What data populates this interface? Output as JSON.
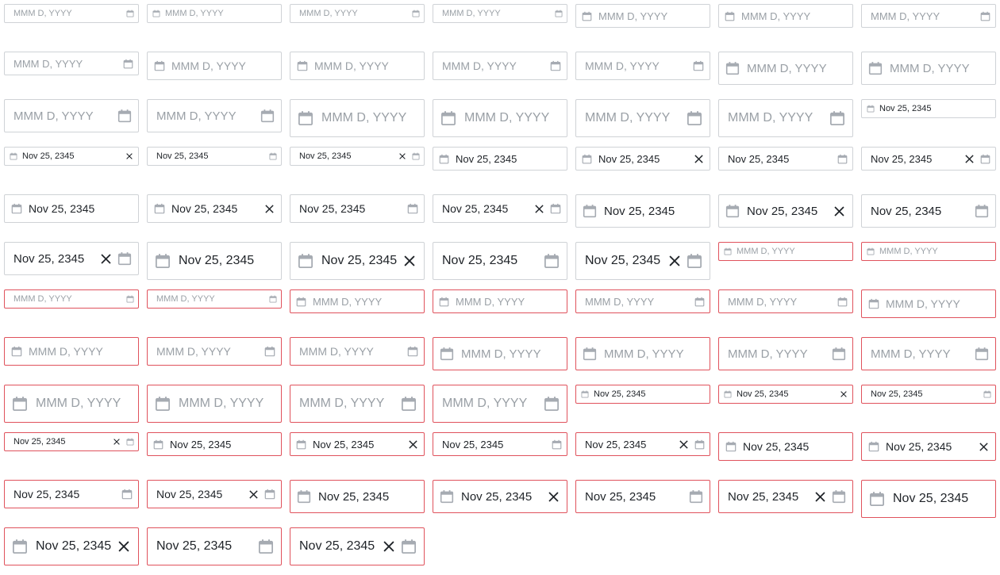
{
  "placeholder": "MMM D, YYYY",
  "date_value": "Nov 25, 2345",
  "colors": {
    "border": "#cfd2d6",
    "invalid_border": "#e0525c",
    "icon": "#a6abb2",
    "text": "#1f2328",
    "placeholder": "#9aa0a6"
  },
  "icons": {
    "calendar": "calendar-icon",
    "clear": "close-icon"
  },
  "fields": [
    {
      "size": "xs",
      "icon": "right",
      "invalid": false,
      "filled": false,
      "clear": false
    },
    {
      "size": "xs",
      "icon": "left",
      "invalid": false,
      "filled": false,
      "clear": false
    },
    {
      "size": "xs",
      "icon": "right",
      "invalid": false,
      "filled": false,
      "clear": false
    },
    {
      "size": "xs",
      "icon": "right",
      "invalid": false,
      "filled": false,
      "clear": false
    },
    {
      "size": "s",
      "icon": "left",
      "invalid": false,
      "filled": false,
      "clear": false
    },
    {
      "size": "s",
      "icon": "left",
      "invalid": false,
      "filled": false,
      "clear": false
    },
    {
      "size": "s",
      "icon": "right",
      "invalid": false,
      "filled": false,
      "clear": false
    },
    {
      "size": "s",
      "icon": "right",
      "invalid": false,
      "filled": false,
      "clear": false
    },
    {
      "size": "m",
      "icon": "left",
      "invalid": false,
      "filled": false,
      "clear": false
    },
    {
      "size": "m",
      "icon": "left",
      "invalid": false,
      "filled": false,
      "clear": false
    },
    {
      "size": "m",
      "icon": "right",
      "invalid": false,
      "filled": false,
      "clear": false
    },
    {
      "size": "m",
      "icon": "right",
      "invalid": false,
      "filled": false,
      "clear": false
    },
    {
      "size": "l",
      "icon": "left",
      "invalid": false,
      "filled": false,
      "clear": false
    },
    {
      "size": "l",
      "icon": "left",
      "invalid": false,
      "filled": false,
      "clear": false
    },
    {
      "size": "l",
      "icon": "right",
      "invalid": false,
      "filled": false,
      "clear": false
    },
    {
      "size": "l",
      "icon": "right",
      "invalid": false,
      "filled": false,
      "clear": false
    },
    {
      "size": "xl",
      "icon": "left",
      "invalid": false,
      "filled": false,
      "clear": false
    },
    {
      "size": "xl",
      "icon": "left",
      "invalid": false,
      "filled": false,
      "clear": false
    },
    {
      "size": "xl",
      "icon": "right",
      "invalid": false,
      "filled": false,
      "clear": false
    },
    {
      "size": "xl",
      "icon": "right",
      "invalid": false,
      "filled": false,
      "clear": false
    },
    {
      "size": "xs",
      "icon": "left",
      "invalid": false,
      "filled": true,
      "clear": false
    },
    {
      "size": "xs",
      "icon": "left",
      "invalid": false,
      "filled": true,
      "clear": true
    },
    {
      "size": "xs",
      "icon": "right",
      "invalid": false,
      "filled": true,
      "clear": false
    },
    {
      "size": "xs",
      "icon": "right",
      "invalid": false,
      "filled": true,
      "clear": true
    },
    {
      "size": "s",
      "icon": "left",
      "invalid": false,
      "filled": true,
      "clear": false
    },
    {
      "size": "s",
      "icon": "left",
      "invalid": false,
      "filled": true,
      "clear": true
    },
    {
      "size": "s",
      "icon": "right",
      "invalid": false,
      "filled": true,
      "clear": false
    },
    {
      "size": "s",
      "icon": "right",
      "invalid": false,
      "filled": true,
      "clear": true
    },
    {
      "size": "m",
      "icon": "left",
      "invalid": false,
      "filled": true,
      "clear": false
    },
    {
      "size": "m",
      "icon": "left",
      "invalid": false,
      "filled": true,
      "clear": true
    },
    {
      "size": "m",
      "icon": "right",
      "invalid": false,
      "filled": true,
      "clear": false
    },
    {
      "size": "m",
      "icon": "right",
      "invalid": false,
      "filled": true,
      "clear": true
    },
    {
      "size": "l",
      "icon": "left",
      "invalid": false,
      "filled": true,
      "clear": false
    },
    {
      "size": "l",
      "icon": "left",
      "invalid": false,
      "filled": true,
      "clear": true
    },
    {
      "size": "l",
      "icon": "right",
      "invalid": false,
      "filled": true,
      "clear": false
    },
    {
      "size": "l",
      "icon": "right",
      "invalid": false,
      "filled": true,
      "clear": true
    },
    {
      "size": "xl",
      "icon": "left",
      "invalid": false,
      "filled": true,
      "clear": false
    },
    {
      "size": "xl",
      "icon": "left",
      "invalid": false,
      "filled": true,
      "clear": true
    },
    {
      "size": "xl",
      "icon": "right",
      "invalid": false,
      "filled": true,
      "clear": false
    },
    {
      "size": "xl",
      "icon": "right",
      "invalid": false,
      "filled": true,
      "clear": true
    },
    {
      "size": "xs",
      "icon": "left",
      "invalid": true,
      "filled": false,
      "clear": false
    },
    {
      "size": "xs",
      "icon": "left",
      "invalid": true,
      "filled": false,
      "clear": false
    },
    {
      "size": "xs",
      "icon": "right",
      "invalid": true,
      "filled": false,
      "clear": false
    },
    {
      "size": "xs",
      "icon": "right",
      "invalid": true,
      "filled": false,
      "clear": false
    },
    {
      "size": "s",
      "icon": "left",
      "invalid": true,
      "filled": false,
      "clear": false
    },
    {
      "size": "s",
      "icon": "left",
      "invalid": true,
      "filled": false,
      "clear": false
    },
    {
      "size": "s",
      "icon": "right",
      "invalid": true,
      "filled": false,
      "clear": false
    },
    {
      "size": "s",
      "icon": "right",
      "invalid": true,
      "filled": false,
      "clear": false
    },
    {
      "size": "m",
      "icon": "left",
      "invalid": true,
      "filled": false,
      "clear": false
    },
    {
      "size": "m",
      "icon": "left",
      "invalid": true,
      "filled": false,
      "clear": false
    },
    {
      "size": "m",
      "icon": "right",
      "invalid": true,
      "filled": false,
      "clear": false
    },
    {
      "size": "m",
      "icon": "right",
      "invalid": true,
      "filled": false,
      "clear": false
    },
    {
      "size": "l",
      "icon": "left",
      "invalid": true,
      "filled": false,
      "clear": false
    },
    {
      "size": "l",
      "icon": "left",
      "invalid": true,
      "filled": false,
      "clear": false
    },
    {
      "size": "l",
      "icon": "right",
      "invalid": true,
      "filled": false,
      "clear": false
    },
    {
      "size": "l",
      "icon": "right",
      "invalid": true,
      "filled": false,
      "clear": false
    },
    {
      "size": "xl",
      "icon": "left",
      "invalid": true,
      "filled": false,
      "clear": false
    },
    {
      "size": "xl",
      "icon": "left",
      "invalid": true,
      "filled": false,
      "clear": false
    },
    {
      "size": "xl",
      "icon": "right",
      "invalid": true,
      "filled": false,
      "clear": false
    },
    {
      "size": "xl",
      "icon": "right",
      "invalid": true,
      "filled": false,
      "clear": false
    },
    {
      "size": "xs",
      "icon": "left",
      "invalid": true,
      "filled": true,
      "clear": false
    },
    {
      "size": "xs",
      "icon": "left",
      "invalid": true,
      "filled": true,
      "clear": true
    },
    {
      "size": "xs",
      "icon": "right",
      "invalid": true,
      "filled": true,
      "clear": false
    },
    {
      "size": "xs",
      "icon": "right",
      "invalid": true,
      "filled": true,
      "clear": true
    },
    {
      "size": "s",
      "icon": "left",
      "invalid": true,
      "filled": true,
      "clear": false
    },
    {
      "size": "s",
      "icon": "left",
      "invalid": true,
      "filled": true,
      "clear": true
    },
    {
      "size": "s",
      "icon": "right",
      "invalid": true,
      "filled": true,
      "clear": false
    },
    {
      "size": "s",
      "icon": "right",
      "invalid": true,
      "filled": true,
      "clear": true
    },
    {
      "size": "m",
      "icon": "left",
      "invalid": true,
      "filled": true,
      "clear": false
    },
    {
      "size": "m",
      "icon": "left",
      "invalid": true,
      "filled": true,
      "clear": true
    },
    {
      "size": "m",
      "icon": "right",
      "invalid": true,
      "filled": true,
      "clear": false
    },
    {
      "size": "m",
      "icon": "right",
      "invalid": true,
      "filled": true,
      "clear": true
    },
    {
      "size": "l",
      "icon": "left",
      "invalid": true,
      "filled": true,
      "clear": false
    },
    {
      "size": "l",
      "icon": "left",
      "invalid": true,
      "filled": true,
      "clear": true
    },
    {
      "size": "l",
      "icon": "right",
      "invalid": true,
      "filled": true,
      "clear": false
    },
    {
      "size": "l",
      "icon": "right",
      "invalid": true,
      "filled": true,
      "clear": true
    },
    {
      "size": "xl",
      "icon": "left",
      "invalid": true,
      "filled": true,
      "clear": false
    },
    {
      "size": "xl",
      "icon": "left",
      "invalid": true,
      "filled": true,
      "clear": true
    },
    {
      "size": "xl",
      "icon": "right",
      "invalid": true,
      "filled": true,
      "clear": false
    },
    {
      "size": "xl",
      "icon": "right",
      "invalid": true,
      "filled": true,
      "clear": true
    }
  ]
}
